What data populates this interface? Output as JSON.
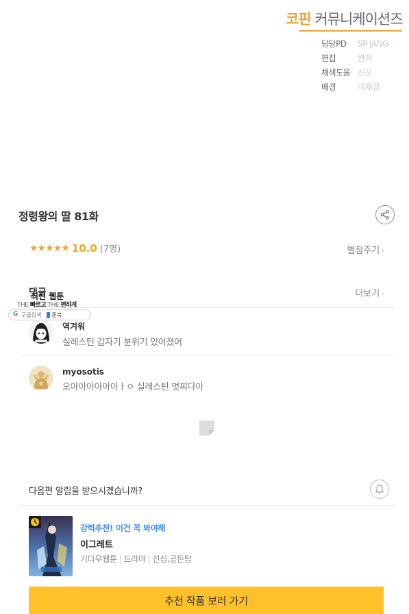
{
  "credits": {
    "brand_part1": "코핀",
    "brand_part2": "커뮤니케이션즈",
    "rows": [
      {
        "role": "담당PD",
        "name": "SP JANG"
      },
      {
        "role": "편집",
        "name": "란하"
      },
      {
        "role": "채색도움",
        "name": "신오"
      },
      {
        "role": "배경",
        "name": "이재경"
      }
    ]
  },
  "episode": {
    "title": "정령왕의 딸 81화"
  },
  "rating": {
    "stars": "★★★★★",
    "score": "10.0",
    "count": "(7명)",
    "rate_link": "별점주기",
    "stars_value": 5
  },
  "comments": {
    "header": "댓글",
    "more_link": "더보기",
    "items": [
      {
        "name": "역겨워",
        "text": "실레스틴 갑자기 분위기 있어졌어",
        "avatar": "girl-avatar"
      },
      {
        "name": "myosotis",
        "text": "오아아아아아아ㅏㅇ 실레스틴 멋찌다아",
        "avatar": "golden-statue-avatar"
      }
    ]
  },
  "widget": {
    "title": "최신 웹툰",
    "tag_prefix1": "THE",
    "tag_word1": "빠르고",
    "tag_prefix2": "THE",
    "tag_word2": "편하게",
    "search_label": "구글검색",
    "book_label": "툰북"
  },
  "notify": {
    "text": "다음편 알림을 받으시겠습니까?"
  },
  "recommendation": {
    "tag": "강력추천! 이건 꼭 봐야해",
    "title": "이그레트",
    "genres": [
      "기다무웹툰",
      "드라마",
      "진심,공든탑"
    ],
    "cta": "추천 작품 보러 가기"
  },
  "colors": {
    "accent": "#ffc12b",
    "star": "#f5a623",
    "brand": "#e7a53b",
    "link_blue": "#3d8bf0"
  }
}
